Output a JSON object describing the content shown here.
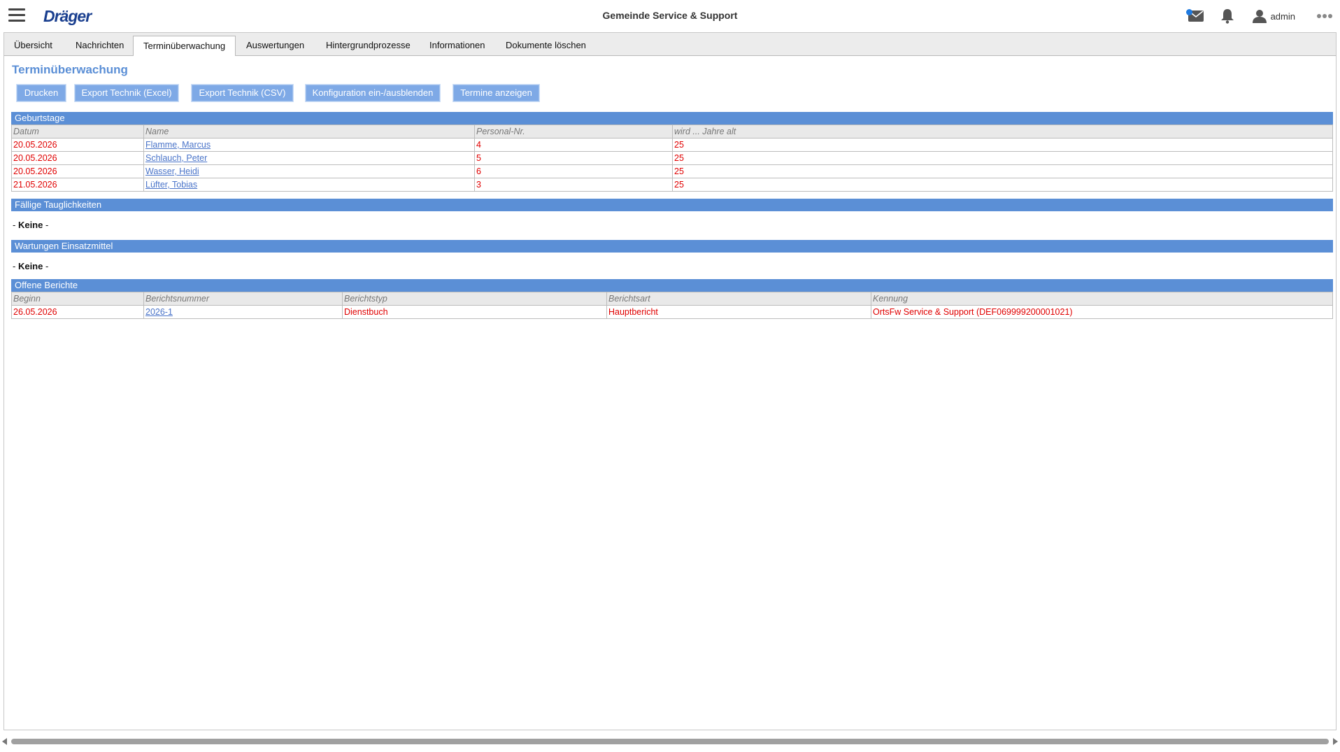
{
  "header": {
    "brand": "Dräger",
    "app_title": "Gemeinde Service & Support",
    "user_name": "admin",
    "icons": [
      "menu-icon",
      "mail-icon",
      "bell-icon",
      "user-icon",
      "more-icon"
    ],
    "accent_color": "#5b8fd6"
  },
  "tabs": [
    {
      "label": "Übersicht",
      "active": false
    },
    {
      "label": "Nachrichten",
      "active": false
    },
    {
      "label": "Terminüberwachung",
      "active": true
    },
    {
      "label": "Auswertungen",
      "active": false
    },
    {
      "label": "Hintergrundprozesse",
      "active": false
    },
    {
      "label": "Informationen",
      "active": false
    },
    {
      "label": "Dokumente löschen",
      "active": false
    }
  ],
  "page": {
    "title": "Terminüberwachung",
    "buttons": {
      "print": "Drucken",
      "export_excel": "Export Technik (Excel)",
      "export_csv": "Export Technik (CSV)",
      "config_toggle": "Konfiguration ein-/ausblenden",
      "show_dates": "Termine anzeigen"
    }
  },
  "birthdays": {
    "title": "Geburtstage",
    "columns": [
      "Datum",
      "Name",
      "Personal-Nr.",
      "wird ... Jahre alt"
    ],
    "rows": [
      {
        "date": "20.05.2026",
        "name": "Flamme, Marcus",
        "personal_nr": "4",
        "age": "25"
      },
      {
        "date": "20.05.2026",
        "name": "Schlauch, Peter",
        "personal_nr": "5",
        "age": "25"
      },
      {
        "date": "20.05.2026",
        "name": "Wasser, Heidi",
        "personal_nr": "6",
        "age": "25"
      },
      {
        "date": "21.05.2026",
        "name": "Lüfter, Tobias",
        "personal_nr": "3",
        "age": "25"
      }
    ]
  },
  "fitness": {
    "title": "Fällige Tauglichkeiten",
    "none_prefix": "- ",
    "none_word": "Keine",
    "none_suffix": " -"
  },
  "maintenance": {
    "title": "Wartungen Einsatzmittel",
    "none_prefix": "- ",
    "none_word": "Keine",
    "none_suffix": " -"
  },
  "reports": {
    "title": "Offene Berichte",
    "columns": [
      "Beginn",
      "Berichtsnummer",
      "Berichtstyp",
      "Berichtsart",
      "Kennung"
    ],
    "rows": [
      {
        "begin": "26.05.2026",
        "number": "2026-1",
        "type": "Dienstbuch",
        "kind": "Hauptbericht",
        "id": "OrtsFw Service & Support (DEF069999200001021)"
      }
    ]
  },
  "colors": {
    "row_text": "#e00000",
    "link": "#4a74c9",
    "section_header": "#5b8fd6",
    "button": "#7ea9e6"
  }
}
